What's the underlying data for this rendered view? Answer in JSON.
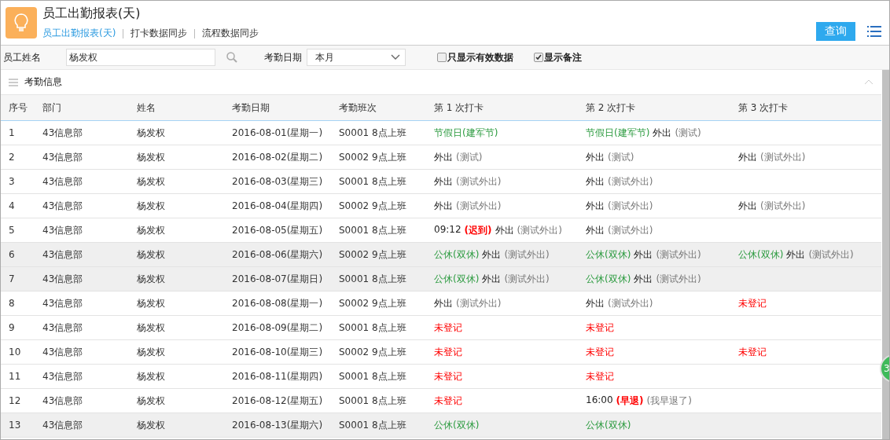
{
  "header": {
    "title": "员工出勤报表(天)",
    "nav": [
      {
        "label": "员工出勤报表(天)",
        "selected": true
      },
      {
        "label": "打卡数据同步",
        "selected": false
      },
      {
        "label": "流程数据同步",
        "selected": false
      }
    ],
    "query_button": "查询"
  },
  "filters": {
    "name_label": "员工姓名",
    "name_value": "杨发权",
    "date_label": "考勤日期",
    "date_value": "本月",
    "options": [
      {
        "label": "只显示有效数据",
        "checked": false
      },
      {
        "label": "显示备注",
        "checked": true
      }
    ]
  },
  "section": {
    "title": "考勤信息",
    "expanded": true
  },
  "table": {
    "columns": [
      "序号",
      "部门",
      "姓名",
      "考勤日期",
      "考勤班次",
      "第 1 次打卡",
      "第 2 次打卡",
      "第 3 次打卡"
    ],
    "rows": [
      {
        "weekend": false,
        "cells": [
          "1",
          "43信息部",
          "杨发权",
          "2016-08-01(星期一)",
          "S0001 8点上班"
        ],
        "punches": [
          [
            {
              "kind": "holiday",
              "text": "节假日(建军节)"
            }
          ],
          [
            {
              "kind": "holiday",
              "text": "节假日(建军节)"
            },
            {
              "kind": "out",
              "text": "外出"
            },
            {
              "kind": "note",
              "text": "(测试)"
            }
          ]
        ]
      },
      {
        "weekend": false,
        "cells": [
          "2",
          "43信息部",
          "杨发权",
          "2016-08-02(星期二)",
          "S0002 9点上班"
        ],
        "punches": [
          [
            {
              "kind": "out",
              "text": "外出"
            },
            {
              "kind": "note",
              "text": "(测试)"
            }
          ],
          [
            {
              "kind": "out",
              "text": "外出"
            },
            {
              "kind": "note",
              "text": "(测试)"
            }
          ],
          [
            {
              "kind": "out",
              "text": "外出"
            },
            {
              "kind": "note",
              "text": "(测试外出)"
            }
          ]
        ]
      },
      {
        "weekend": false,
        "cells": [
          "3",
          "43信息部",
          "杨发权",
          "2016-08-03(星期三)",
          "S0001 8点上班"
        ],
        "punches": [
          [
            {
              "kind": "out",
              "text": "外出"
            },
            {
              "kind": "note",
              "text": "(测试外出)"
            }
          ],
          [
            {
              "kind": "out",
              "text": "外出"
            },
            {
              "kind": "note",
              "text": "(测试外出)"
            }
          ]
        ]
      },
      {
        "weekend": false,
        "cells": [
          "4",
          "43信息部",
          "杨发权",
          "2016-08-04(星期四)",
          "S0002 9点上班"
        ],
        "punches": [
          [
            {
              "kind": "out",
              "text": "外出"
            },
            {
              "kind": "note",
              "text": "(测试外出)"
            }
          ],
          [
            {
              "kind": "out",
              "text": "外出"
            },
            {
              "kind": "note",
              "text": "(测试外出)"
            }
          ],
          [
            {
              "kind": "out",
              "text": "外出"
            },
            {
              "kind": "note",
              "text": "(测试外出)"
            }
          ]
        ]
      },
      {
        "weekend": false,
        "cells": [
          "5",
          "43信息部",
          "杨发权",
          "2016-08-05(星期五)",
          "S0001 8点上班"
        ],
        "punches": [
          [
            {
              "kind": "time",
              "text": "09:12"
            },
            {
              "kind": "flag",
              "text": "(迟到)"
            },
            {
              "kind": "out",
              "text": "外出"
            },
            {
              "kind": "note",
              "text": "(测试外出)"
            }
          ],
          [
            {
              "kind": "out",
              "text": "外出"
            },
            {
              "kind": "note",
              "text": "(测试外出)"
            }
          ]
        ]
      },
      {
        "weekend": true,
        "cells": [
          "6",
          "43信息部",
          "杨发权",
          "2016-08-06(星期六)",
          "S0002 9点上班"
        ],
        "punches": [
          [
            {
              "kind": "holiday",
              "text": "公休(双休)"
            },
            {
              "kind": "out",
              "text": "外出"
            },
            {
              "kind": "note",
              "text": "(测试外出)"
            }
          ],
          [
            {
              "kind": "holiday",
              "text": "公休(双休)"
            },
            {
              "kind": "out",
              "text": "外出"
            },
            {
              "kind": "note",
              "text": "(测试外出)"
            }
          ],
          [
            {
              "kind": "holiday",
              "text": "公休(双休)"
            },
            {
              "kind": "out",
              "text": "外出"
            },
            {
              "kind": "note",
              "text": "(测试外出)"
            }
          ]
        ]
      },
      {
        "weekend": true,
        "cells": [
          "7",
          "43信息部",
          "杨发权",
          "2016-08-07(星期日)",
          "S0001 8点上班"
        ],
        "punches": [
          [
            {
              "kind": "holiday",
              "text": "公休(双休)"
            },
            {
              "kind": "out",
              "text": "外出"
            },
            {
              "kind": "note",
              "text": "(测试外出)"
            }
          ],
          [
            {
              "kind": "holiday",
              "text": "公休(双休)"
            },
            {
              "kind": "out",
              "text": "外出"
            },
            {
              "kind": "note",
              "text": "(测试外出)"
            }
          ]
        ]
      },
      {
        "weekend": false,
        "cells": [
          "8",
          "43信息部",
          "杨发权",
          "2016-08-08(星期一)",
          "S0002 9点上班"
        ],
        "punches": [
          [
            {
              "kind": "out",
              "text": "外出"
            },
            {
              "kind": "note",
              "text": "(测试外出)"
            }
          ],
          [
            {
              "kind": "out",
              "text": "外出"
            },
            {
              "kind": "note",
              "text": "(测试外出)"
            }
          ],
          [
            {
              "kind": "missing",
              "text": "未登记"
            }
          ]
        ]
      },
      {
        "weekend": false,
        "cells": [
          "9",
          "43信息部",
          "杨发权",
          "2016-08-09(星期二)",
          "S0001 8点上班"
        ],
        "punches": [
          [
            {
              "kind": "missing",
              "text": "未登记"
            }
          ],
          [
            {
              "kind": "missing",
              "text": "未登记"
            }
          ]
        ]
      },
      {
        "weekend": false,
        "cells": [
          "10",
          "43信息部",
          "杨发权",
          "2016-08-10(星期三)",
          "S0002 9点上班"
        ],
        "punches": [
          [
            {
              "kind": "missing",
              "text": "未登记"
            }
          ],
          [
            {
              "kind": "missing",
              "text": "未登记"
            }
          ],
          [
            {
              "kind": "missing",
              "text": "未登记"
            }
          ]
        ]
      },
      {
        "weekend": false,
        "cells": [
          "11",
          "43信息部",
          "杨发权",
          "2016-08-11(星期四)",
          "S0001 8点上班"
        ],
        "punches": [
          [
            {
              "kind": "missing",
              "text": "未登记"
            }
          ],
          [
            {
              "kind": "missing",
              "text": "未登记"
            }
          ]
        ]
      },
      {
        "weekend": false,
        "cells": [
          "12",
          "43信息部",
          "杨发权",
          "2016-08-12(星期五)",
          "S0001 8点上班"
        ],
        "punches": [
          [
            {
              "kind": "missing",
              "text": "未登记"
            }
          ],
          [
            {
              "kind": "time",
              "text": "16:00"
            },
            {
              "kind": "flag",
              "text": "(早退)"
            },
            {
              "kind": "note",
              "text": "(我早退了)"
            }
          ]
        ]
      },
      {
        "weekend": true,
        "cells": [
          "13",
          "43信息部",
          "杨发权",
          "2016-08-13(星期六)",
          "S0001 8点上班"
        ],
        "punches": [
          [
            {
              "kind": "holiday",
              "text": "公休(双休)"
            }
          ],
          [
            {
              "kind": "holiday",
              "text": "公休(双休)"
            }
          ]
        ]
      }
    ]
  },
  "floating_badge": "3"
}
